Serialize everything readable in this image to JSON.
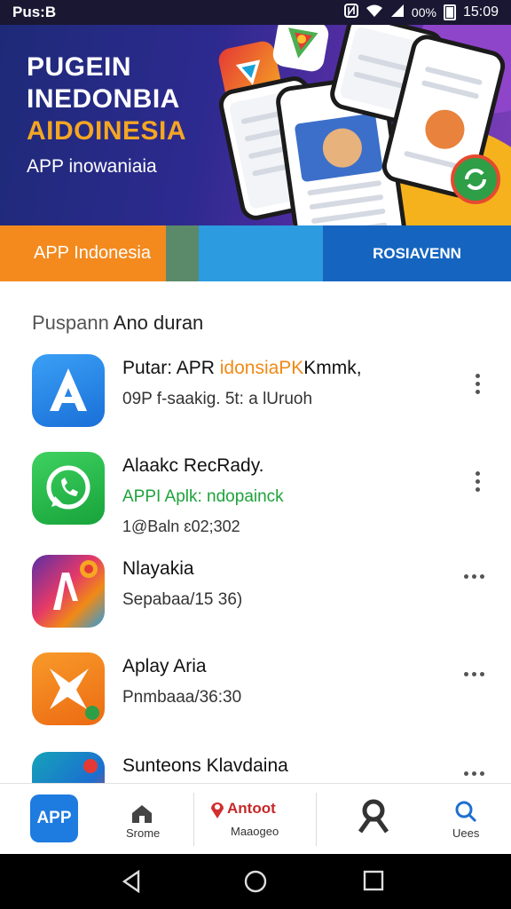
{
  "status_bar": {
    "left": "Pus:B",
    "battery": "00%",
    "time": "15:09"
  },
  "banner": {
    "title_line1": "PUGEIN",
    "title_line2": "INEDONBIA",
    "title_line3": "AIDOINESIA",
    "subtitle": "APP inowaniaia",
    "colors": {
      "accent": "#f5a623",
      "background": "#2d2a8f"
    }
  },
  "tabs": {
    "tab1": "APP Indonesia",
    "tab3": "ROSIAVENN"
  },
  "section": {
    "title_part1": "Puspann",
    "title_part2": "Ano duran"
  },
  "apps": [
    {
      "name_a": "Putar: APR",
      "name_b": "idonsiaPK",
      "name_c": "Kmmk,",
      "line2": "09P f-saakig. 5t: a lUruoh",
      "menu": "vertical-dots",
      "icon": "app-store-a-icon"
    },
    {
      "name": "Alaakc RecRady.",
      "line2": "APPI Aplk: ndopainck",
      "line3": "1@Baln ɛ02;302",
      "menu": "vertical-dots",
      "icon": "whatsapp-phone-icon"
    },
    {
      "name": "Nlayakia",
      "line2": "Sepabaa/15 36)",
      "menu": "horizontal-dots",
      "icon": "multicolor-n-icon"
    },
    {
      "name": "Aplay Aria",
      "line2": "Pnmbaaa/36:30",
      "menu": "horizontal-dots",
      "icon": "orange-star-icon"
    },
    {
      "name": "Sunteons Klavdaina",
      "menu": "horizontal-dots",
      "icon": "teal-app-icon"
    }
  ],
  "bottom_nav": {
    "app_button": "APP",
    "home_label": "Srome",
    "promo_title": "Antoot",
    "promo_label": "Maaogeo",
    "search_label": "Uees"
  }
}
